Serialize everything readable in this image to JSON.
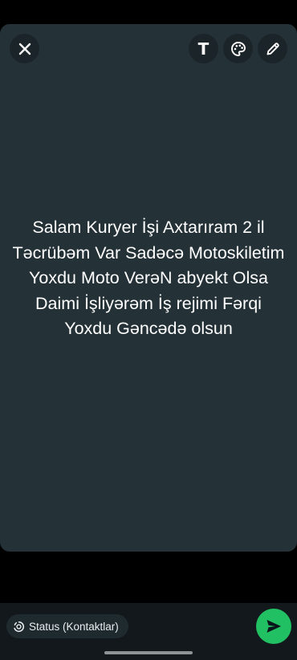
{
  "colors": {
    "canvas_background": "#243238",
    "send_button": "#21c063",
    "text": "#ffffff"
  },
  "toolbar": {
    "close_icon": "close-icon",
    "text_tool_label": "T",
    "palette_icon": "palette-icon",
    "pencil_icon": "pencil-icon"
  },
  "status": {
    "text": "Salam Kuryer İşi Axtarıram 2 il Təcrübəm Var Sadəcə Motoskiletim Yoxdu Moto VerəN abyekt Olsa Daimi İşliyərəm İş rejimi Fərqi Yoxdu Gəncədə olsun"
  },
  "footer": {
    "audience_icon": "status-privacy-icon",
    "audience_label": "Status (Kontaktlar)",
    "send_icon": "send-icon"
  }
}
